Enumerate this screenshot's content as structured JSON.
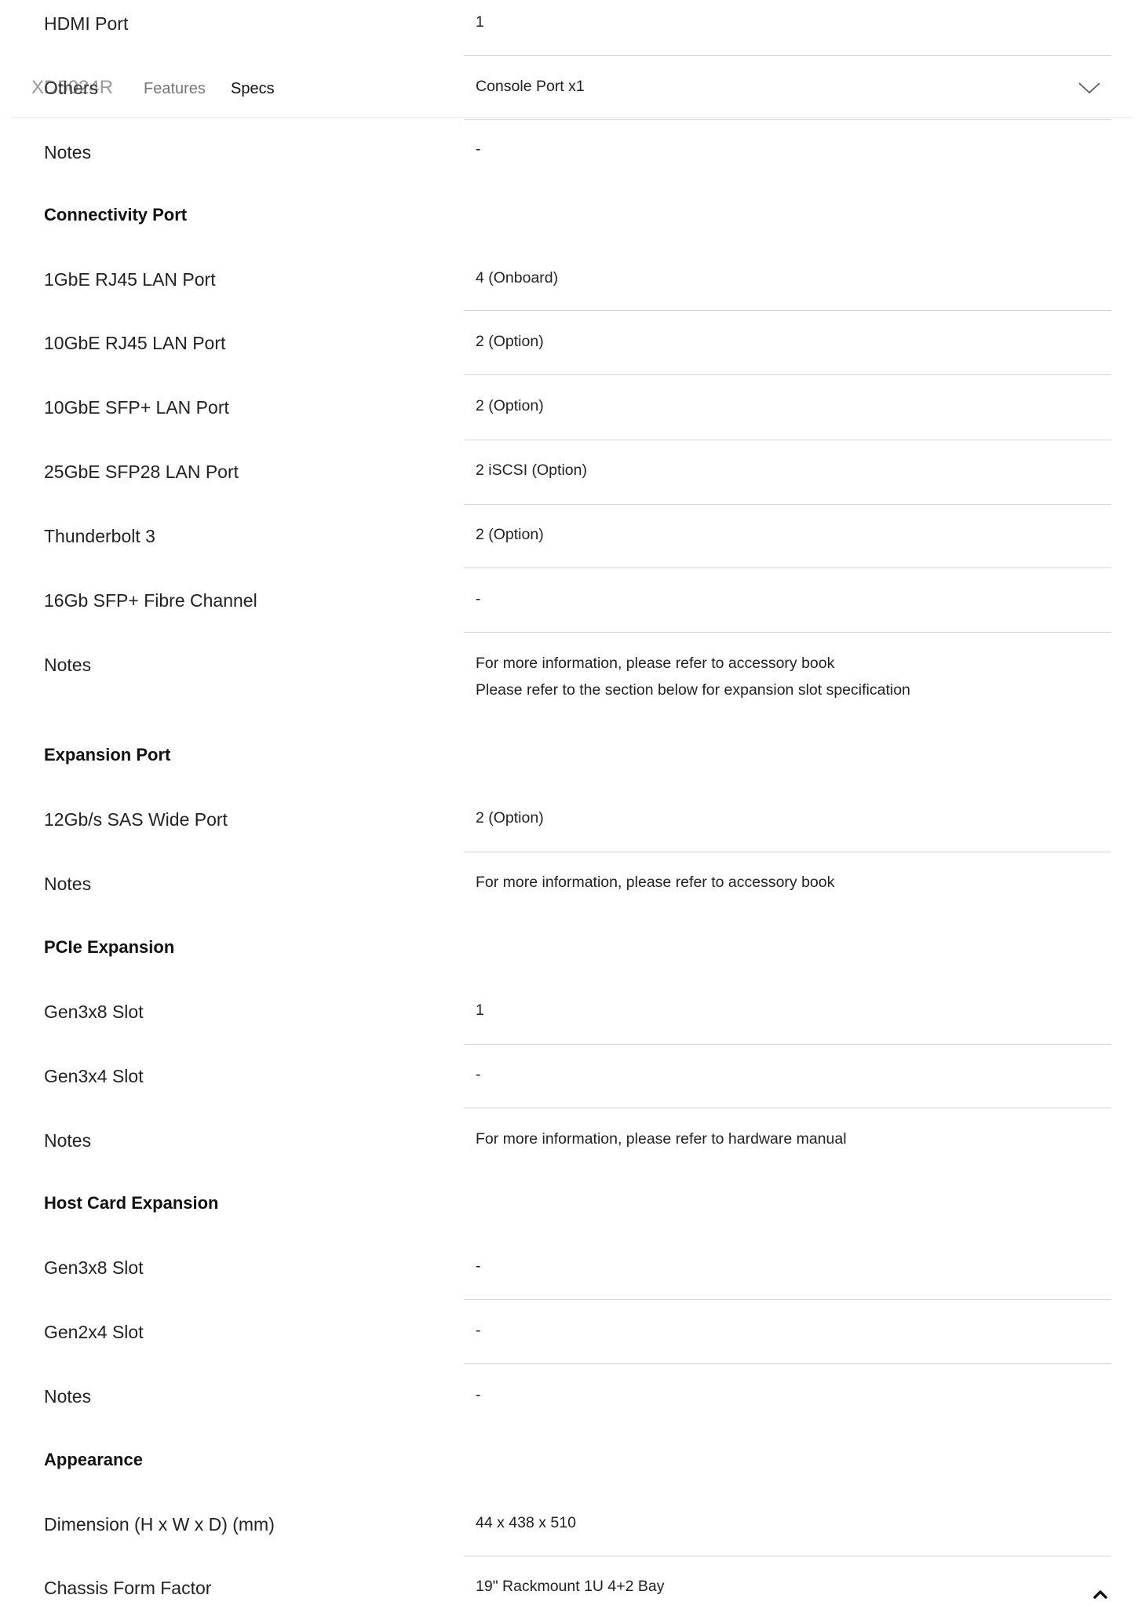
{
  "sticky_header": {
    "product_name": "XD5024R",
    "nav": {
      "features_label": "Features",
      "specs_label": "Specs"
    },
    "expander_icon": "chevron-down-icon"
  },
  "back_to_top_icon": "chevron-up-icon",
  "rows": {
    "hdmi_port": {
      "label": "HDMI Port",
      "value": "1"
    },
    "others": {
      "label": "Others",
      "value": "Console Port x1"
    },
    "display_notes": {
      "label": "Notes",
      "value": "-"
    },
    "connectivity_title": "Connectivity Port",
    "lan_1gbe_rj45": {
      "label": "1GbE RJ45 LAN Port",
      "value": "4 (Onboard)"
    },
    "lan_10gbe_rj45": {
      "label": "10GbE RJ45 LAN Port",
      "value": "2 (Option)"
    },
    "lan_10gbe_sfp": {
      "label": "10GbE SFP+ LAN Port",
      "value": "2 (Option)"
    },
    "lan_25gbe_sfp28": {
      "label": "25GbE SFP28 LAN Port",
      "value": "2 iSCSI (Option)"
    },
    "thunderbolt3": {
      "label": "Thunderbolt 3",
      "value": "2 (Option)"
    },
    "fibre_16gb": {
      "label": "16Gb SFP+ Fibre Channel",
      "value": "-"
    },
    "connectivity_notes": {
      "label": "Notes",
      "value_line1": "For more information, please refer to accessory book",
      "value_line2": "Please refer to the section below for expansion slot specification"
    },
    "expansion_title": "Expansion Port",
    "sas_wide": {
      "label": "12Gb/s SAS Wide Port",
      "value": "2 (Option)"
    },
    "expansion_notes": {
      "label": "Notes",
      "value": "For more information, please refer to accessory book"
    },
    "pcie_title": "PCIe Expansion",
    "pcie_gen3x8": {
      "label": "Gen3x8 Slot",
      "value": "1"
    },
    "pcie_gen3x4": {
      "label": "Gen3x4 Slot",
      "value": "-"
    },
    "pcie_notes": {
      "label": "Notes",
      "value": "For more information, please refer to hardware manual"
    },
    "host_title": "Host Card Expansion",
    "host_gen3x8": {
      "label": "Gen3x8 Slot",
      "value": "-"
    },
    "host_gen2x4": {
      "label": "Gen2x4 Slot",
      "value": "-"
    },
    "host_notes": {
      "label": "Notes",
      "value": "-"
    },
    "appearance_title": "Appearance",
    "dimension": {
      "label": "Dimension (H x W x D) (mm)",
      "value": "44 x 438 x 510"
    },
    "chassis": {
      "label": "Chassis Form Factor",
      "value": "19\" Rackmount 1U 4+2 Bay"
    }
  }
}
